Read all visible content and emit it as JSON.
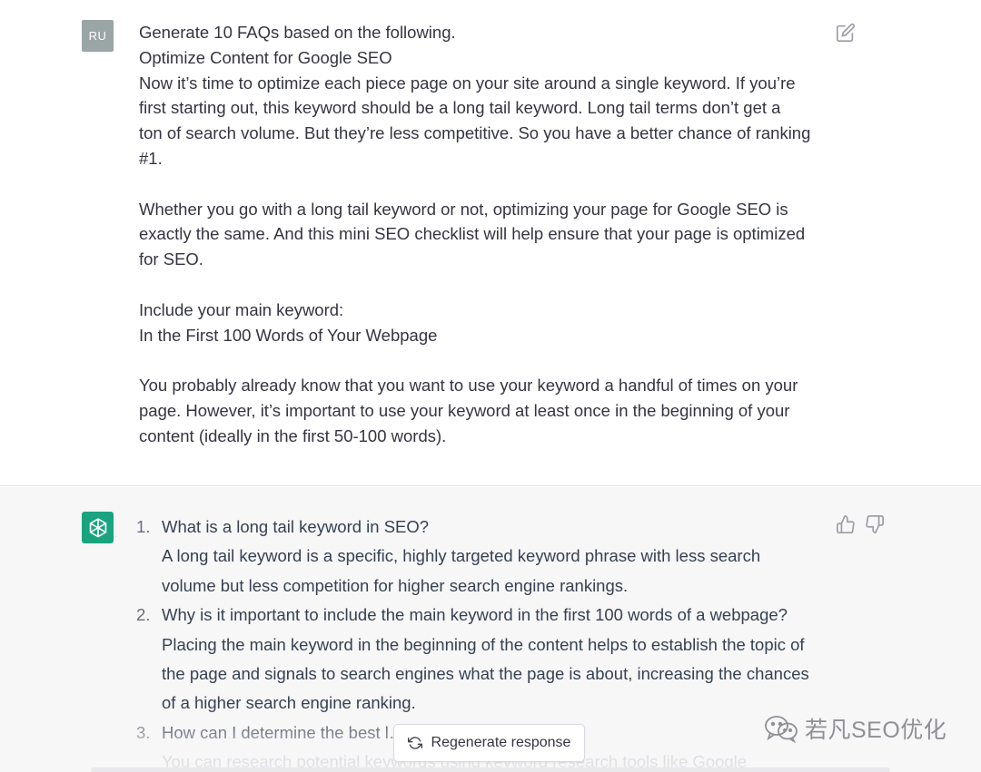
{
  "user_message": {
    "avatar_initials": "RU",
    "lines": [
      "Generate 10 FAQs based on the following.",
      "Optimize Content for Google SEO",
      "Now it’s time to optimize each piece page on your site around a single keyword. If you’re",
      "first starting out, this keyword should be a long tail keyword. Long tail terms don’t get a",
      "ton of search volume. But they’re less competitive. So you have a better chance of ranking",
      "#1.",
      "",
      "Whether you go with a long tail keyword or not, optimizing your page for Google SEO is",
      "exactly the same. And this mini SEO checklist will help ensure that your page is optimized",
      "for SEO.",
      "",
      "Include your main keyword:",
      "In the First 100 Words of Your Webpage",
      "",
      "You probably already know that you want to use your keyword a handful of times on your",
      "page. However, it’s important to use your keyword at least once in the beginning of your",
      "content (ideally in the first 50-100 words)."
    ]
  },
  "assistant_message": {
    "faqs": [
      {
        "number": "1.",
        "question": "What is a long tail keyword in SEO?",
        "answer_lines": [
          "A long tail keyword is a specific, highly targeted keyword phrase with less search",
          "volume but less competition for higher search engine rankings."
        ]
      },
      {
        "number": "2.",
        "question": "Why is it important to include the main keyword in the first 100 words of a webpage?",
        "answer_lines": [
          "Placing the main keyword in the beginning of the content helps to establish the topic of",
          "the page and signals to search engines what the page is about, increasing the chances",
          "of a higher search engine ranking."
        ]
      },
      {
        "number": "3.",
        "question": "How can I determine the best l… …ebpage?",
        "answer_lines": [
          "You can research potential keywords using keyword research tools like Google"
        ]
      }
    ]
  },
  "controls": {
    "regenerate_label": "Regenerate response"
  },
  "watermark": {
    "text": "若凡SEO优化",
    "icon": "wechat-icon"
  },
  "colors": {
    "assistant_avatar_bg": "#19a37f",
    "user_avatar_bg": "#9aa5a5",
    "assistant_bg": "#f7f7f8"
  }
}
